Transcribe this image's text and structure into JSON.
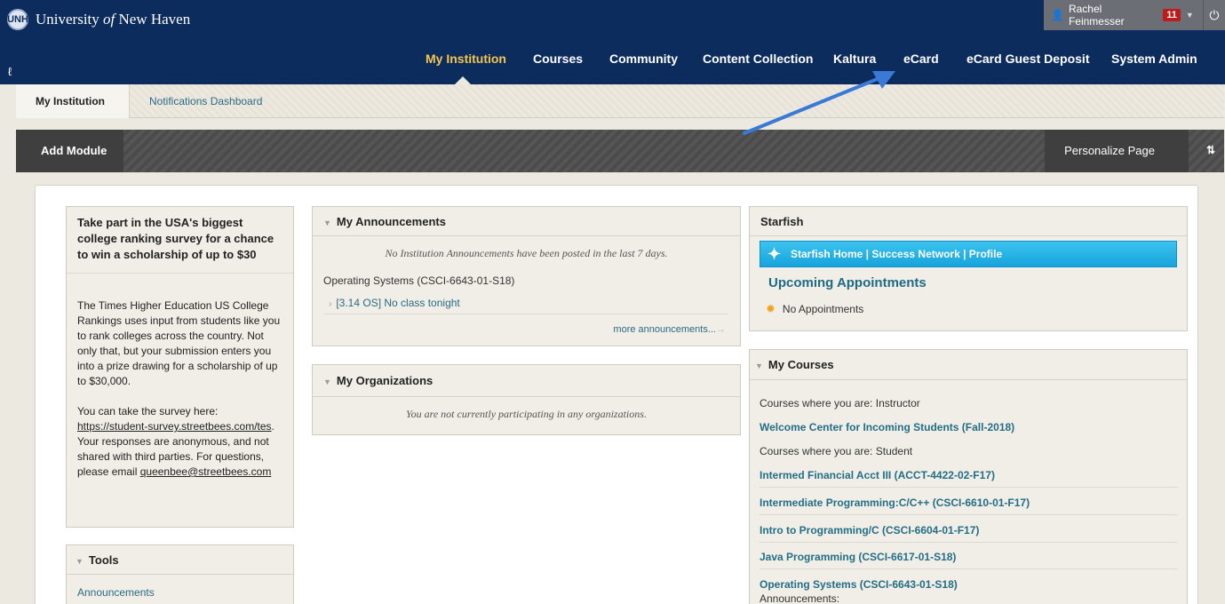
{
  "header": {
    "logo_text": "UNH",
    "university_pre": "University ",
    "university_of": "of",
    "university_post": " New Haven",
    "link_icon": "𝒎",
    "user_name": "Rachel Feinmesser",
    "notif_count": "11"
  },
  "nav": {
    "items": [
      {
        "label": "My Institution"
      },
      {
        "label": "Courses"
      },
      {
        "label": "Community"
      },
      {
        "label": "Content Collection"
      },
      {
        "label": "Kaltura"
      },
      {
        "label": "eCard"
      },
      {
        "label": "eCard Guest Deposit"
      },
      {
        "label": "System Admin"
      }
    ]
  },
  "subnav": {
    "tabs": [
      {
        "label": "My Institution"
      },
      {
        "label": "Notifications Dashboard"
      }
    ]
  },
  "modbar": {
    "add_module": "Add Module",
    "personalize": "Personalize Page"
  },
  "promo": {
    "title": "Take part in the USA's biggest college ranking survey for a chance to win a scholarship of up to $30",
    "para1": "The Times Higher Education US College Rankings uses input from students like you to rank colleges across the country. Not only that, but your submission enters you into a prize drawing for a scholarship of up to $30,000.",
    "para2_a": "You can take the survey here: ",
    "survey_link": "https://student-survey.streetbees.com/tes",
    "para2_b": ". Your responses are anonymous, and not shared with third parties. For questions, please email ",
    "email_link": "queenbee@streetbees.com"
  },
  "tools": {
    "title": "Tools",
    "items": [
      "Announcements"
    ]
  },
  "announcements": {
    "title": "My Announcements",
    "empty": "No Institution Announcements have been posted in the last 7 days.",
    "course": "Operating Systems (CSCI-6643-01-S18)",
    "item": "[3.14 OS] No class tonight",
    "more": "more announcements..."
  },
  "organizations": {
    "title": "My Organizations",
    "empty": "You are not currently participating in any organizations."
  },
  "starfish": {
    "title": "Starfish",
    "bar": "Starfish Home | Success Network | Profile",
    "appt_title": "Upcoming Appointments",
    "appt_empty": "No Appointments"
  },
  "courses": {
    "title": "My Courses",
    "instructor_label": "Courses where you are: Instructor",
    "instructor_courses": [
      "Welcome Center for Incoming Students (Fall-2018)"
    ],
    "student_label": "Courses where you are: Student",
    "student_courses": [
      "Intermed Financial Acct III (ACCT-4422-02-F17)",
      "Intermediate Programming:C/C++ (CSCI-6610-01-F17)",
      "Intro to Programming/C (CSCI-6604-01-F17)",
      "Java Programming (CSCI-6617-01-S18)",
      "Operating Systems (CSCI-6643-01-S18)"
    ],
    "sub_label": "Announcements:"
  },
  "colors": {
    "header_bg": "#0d2c5e",
    "active_nav": "#f4c64f",
    "link": "#2a6b83",
    "starfish_bar": "#17a4dc",
    "annotation_arrow": "#3a79d6"
  }
}
